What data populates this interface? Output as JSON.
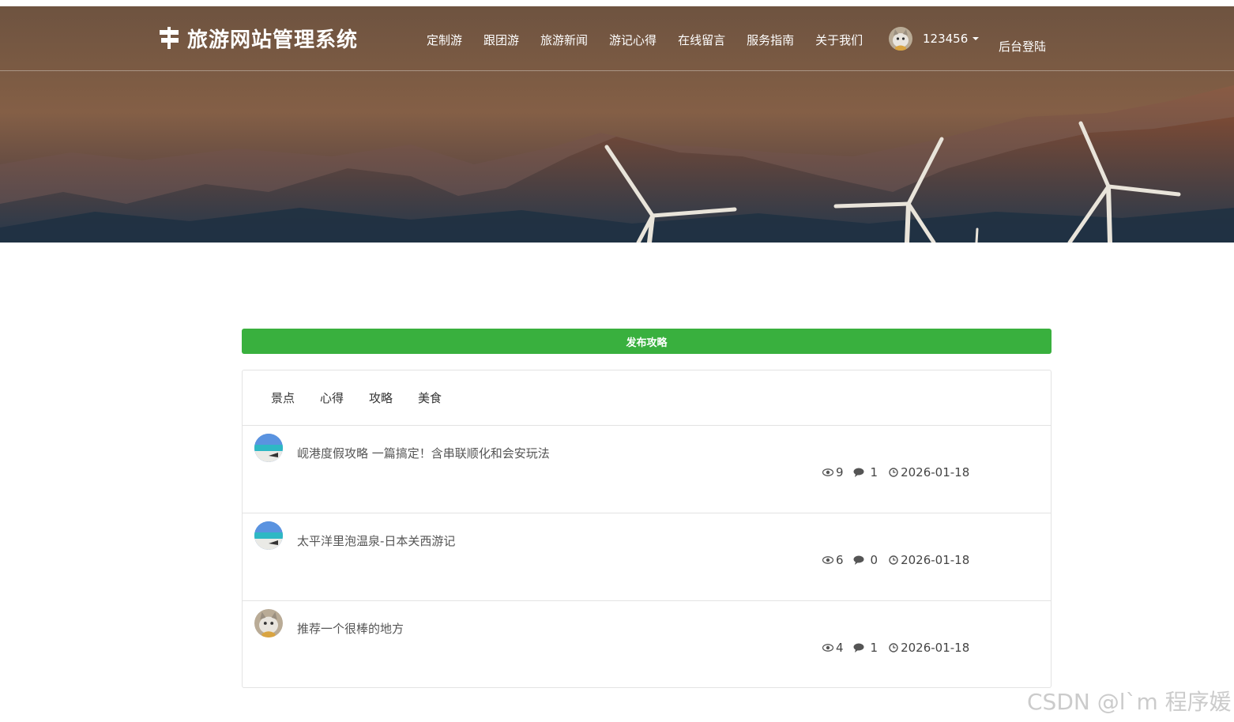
{
  "header": {
    "brand_title": "旅游网站管理系统",
    "nav_items": [
      {
        "label": "定制游"
      },
      {
        "label": "跟团游"
      },
      {
        "label": "旅游新闻"
      },
      {
        "label": "游记心得"
      },
      {
        "label": "在线留言"
      },
      {
        "label": "服务指南"
      },
      {
        "label": "关于我们"
      }
    ],
    "user": {
      "name": "123456",
      "avatar": "cat-avatar"
    },
    "admin_login": "后台登陆"
  },
  "publish_button": "发布攻略",
  "tabs": [
    {
      "label": "景点"
    },
    {
      "label": "心得"
    },
    {
      "label": "攻略"
    },
    {
      "label": "美食"
    }
  ],
  "posts": [
    {
      "title": "岘港度假攻略 一篇搞定！含串联顺化和会安玩法",
      "views": "9",
      "comments": "1",
      "date": "2026-01-18",
      "avatar": "beach-avatar"
    },
    {
      "title": "太平洋里泡温泉-日本关西游记",
      "views": "6",
      "comments": "0",
      "date": "2026-01-18",
      "avatar": "beach-avatar"
    },
    {
      "title": "推荐一个很棒的地方",
      "views": "4",
      "comments": "1",
      "date": "2026-01-18",
      "avatar": "cat-avatar"
    }
  ],
  "watermark": "CSDN @l`m 程序媛",
  "colors": {
    "accent_green": "#39b03e",
    "header_brown": "#7a5a43"
  }
}
